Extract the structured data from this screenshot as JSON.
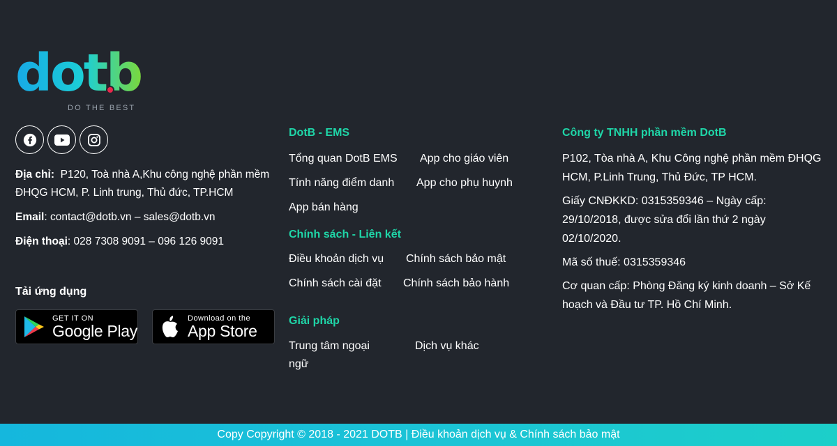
{
  "brand": {
    "logo_text": "dotb",
    "slogan": "DO THE BEST"
  },
  "social": [
    {
      "icon": "facebook-icon"
    },
    {
      "icon": "youtube-icon"
    },
    {
      "icon": "instagram-icon"
    }
  ],
  "contact": {
    "address_label": "Địa chỉ:",
    "address_value": "P120, Toà nhà A,Khu công nghệ phần mềm ĐHQG HCM, P. Linh trung, Thủ đức, TP.HCM",
    "email_label": "Email",
    "email_value": ": contact@dotb.vn – sales@dotb.vn",
    "phone_label": "Điện thoại",
    "phone_value": ": 028 7308 9091 – 096 126 9091"
  },
  "apps": {
    "title": "Tải ứng dụng",
    "google_small": "GET IT ON",
    "google_big": "Google Play",
    "apple_small": "Download on the",
    "apple_big": "App Store"
  },
  "ems": {
    "heading": "DotB - EMS",
    "links": [
      "Tổng quan DotB EMS",
      "App cho giáo viên",
      "Tính năng điểm danh",
      "App cho phụ huynh",
      "App bán hàng"
    ]
  },
  "policy": {
    "heading": "Chính sách - Liên kết",
    "links": [
      "Điều khoản dịch vụ",
      "Chính sách bảo mật",
      "Chính sách cài đặt",
      "Chính sách bảo hành"
    ]
  },
  "solutions": {
    "heading": "Giải pháp",
    "links": [
      "Trung tâm ngoại ngữ",
      "Dịch vụ khác"
    ]
  },
  "company": {
    "heading": "Công ty TNHH phần mềm DotB",
    "address": "P102, Tòa nhà A, Khu Công nghệ phần mềm ĐHQG HCM, P.Linh Trung, Thủ Đức, TP HCM.",
    "license": "Giấy CNĐKKD: 0315359346 – Ngày cấp: 29/10/2018, được sửa đổi lần thứ 2 ngày 02/10/2020.",
    "tax": "Mã số thuế: 0315359346",
    "authority": "Cơ quan cấp: Phòng Đăng ký kinh doanh – Sở Kế hoạch và Đầu tư TP. Hồ Chí Minh."
  },
  "copyright": "Copy Copyright © 2018 - 2021 DOTB | Điều khoản dịch vụ & Chính sách bảo mật",
  "colors": {
    "background": "#22262d",
    "accent_green": "#1fd6a8",
    "bar": "#15b7dd"
  }
}
